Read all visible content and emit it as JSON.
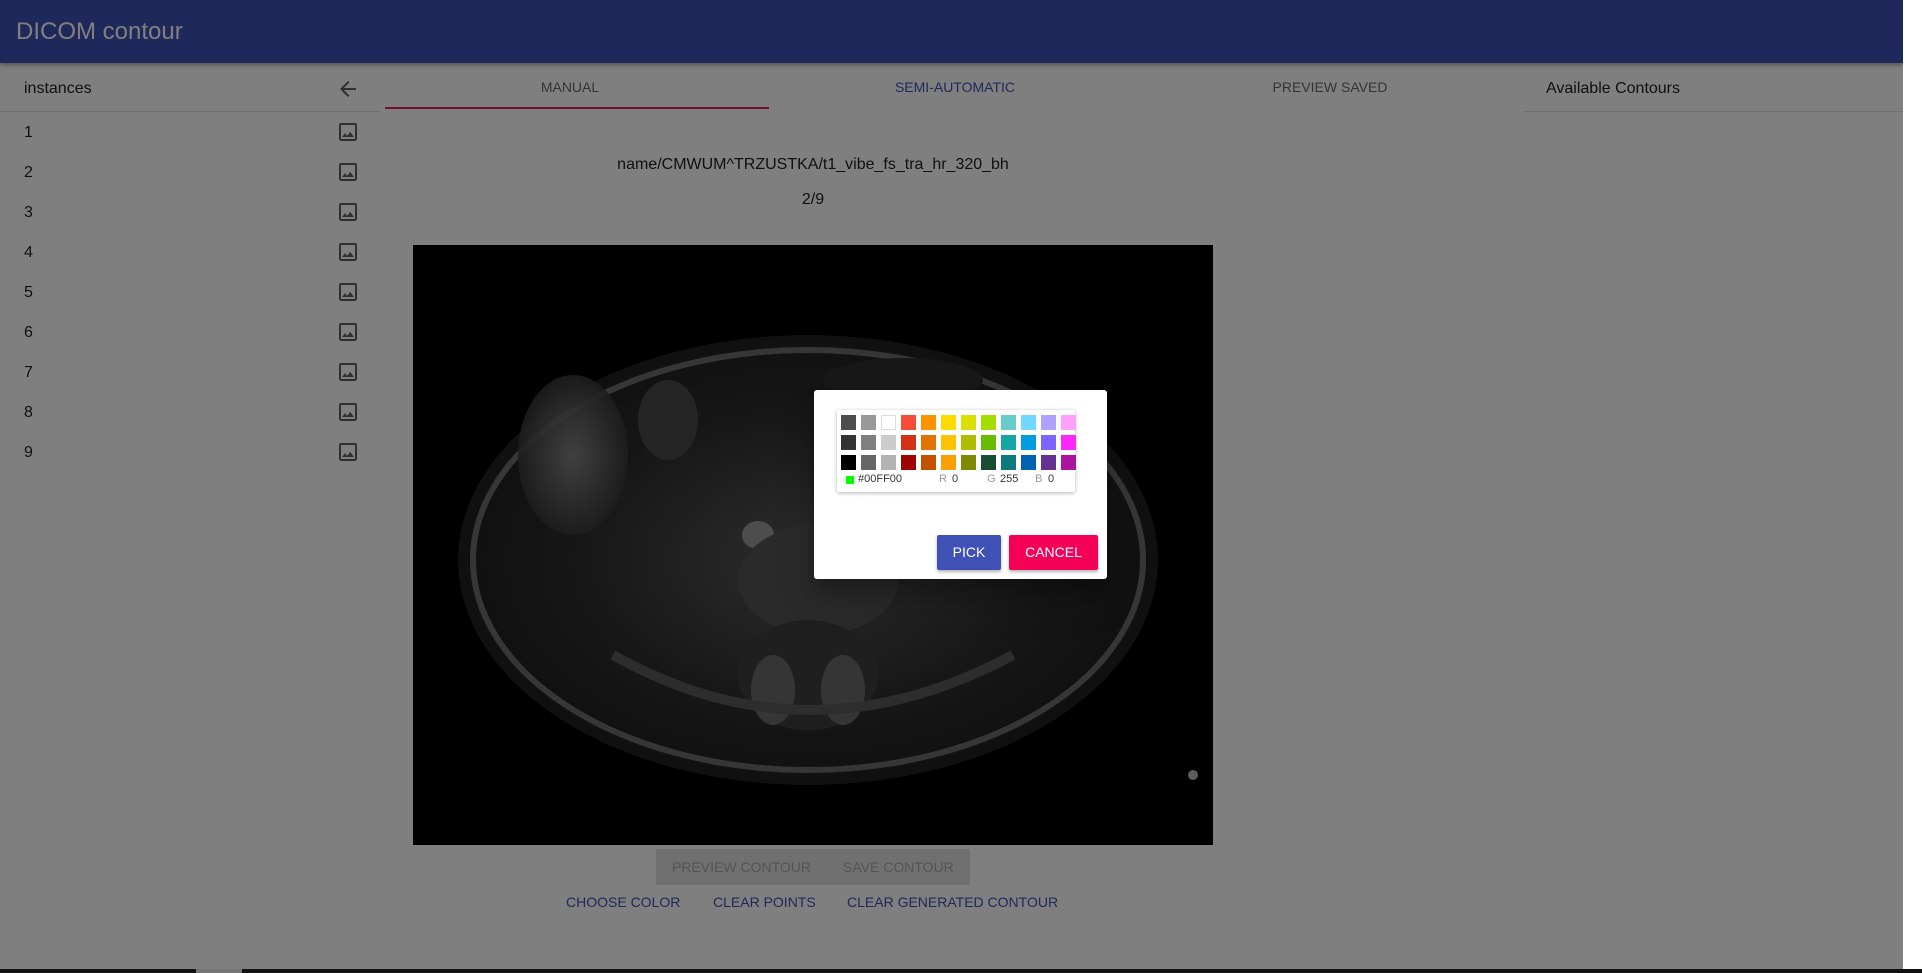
{
  "app": {
    "title": "DICOM contour"
  },
  "sidebar": {
    "title": "instances",
    "back_icon": "arrow-left-icon",
    "items": [
      {
        "label": "1",
        "icon": "image-icon"
      },
      {
        "label": "2",
        "icon": "image-icon"
      },
      {
        "label": "3",
        "icon": "image-icon"
      },
      {
        "label": "4",
        "icon": "image-icon"
      },
      {
        "label": "5",
        "icon": "image-icon"
      },
      {
        "label": "6",
        "icon": "image-icon"
      },
      {
        "label": "7",
        "icon": "image-icon"
      },
      {
        "label": "8",
        "icon": "image-icon"
      },
      {
        "label": "9",
        "icon": "image-icon"
      }
    ]
  },
  "tabs": [
    {
      "label": "MANUAL",
      "active": false
    },
    {
      "label": "SEMI-AUTOMATIC",
      "active": true
    },
    {
      "label": "PREVIEW SAVED",
      "active": false
    }
  ],
  "viewer": {
    "file_name": "name/CMWUM^TRZUSTKA/t1_vibe_fs_tra_hr_320_bh",
    "counter": "2/9"
  },
  "actions": {
    "preview_contour": "PREVIEW CONTOUR",
    "save_contour": "SAVE CONTOUR",
    "choose_color": "CHOOSE COLOR",
    "clear_points": "CLEAR POINTS",
    "clear_generated_contour": "CLEAR GENERATED CONTOUR"
  },
  "right_panel": {
    "title": "Available Contours"
  },
  "color_dialog": {
    "swatches": [
      [
        "#4d4d4d",
        "#999999",
        "#ffffff",
        "#f44e3b",
        "#fe9200",
        "#fcdc00",
        "#dbdf00",
        "#a4dd00",
        "#68ccca",
        "#73d8ff",
        "#aea1ff",
        "#fda1ff"
      ],
      [
        "#333333",
        "#808080",
        "#cccccc",
        "#d33115",
        "#e27300",
        "#fcc400",
        "#b0bc00",
        "#68bc00",
        "#16a5a5",
        "#009ce0",
        "#7b64ff",
        "#fa28ff"
      ],
      [
        "#000000",
        "#666666",
        "#b3b3b3",
        "#9f0500",
        "#c45100",
        "#fb9e00",
        "#808900",
        "#194d33",
        "#0c797d",
        "#0062b1",
        "#653294",
        "#ab149e"
      ]
    ],
    "hex": "#00FF00",
    "r_label": "R",
    "r_value": "0",
    "g_label": "G",
    "g_value": "255",
    "b_label": "B",
    "b_value": "0",
    "pick_label": "PICK",
    "cancel_label": "CANCEL"
  },
  "colors": {
    "primary": "#3f51b5",
    "accent": "#e91e63",
    "cancel": "#f50057",
    "selected_color": "#00ff00"
  }
}
